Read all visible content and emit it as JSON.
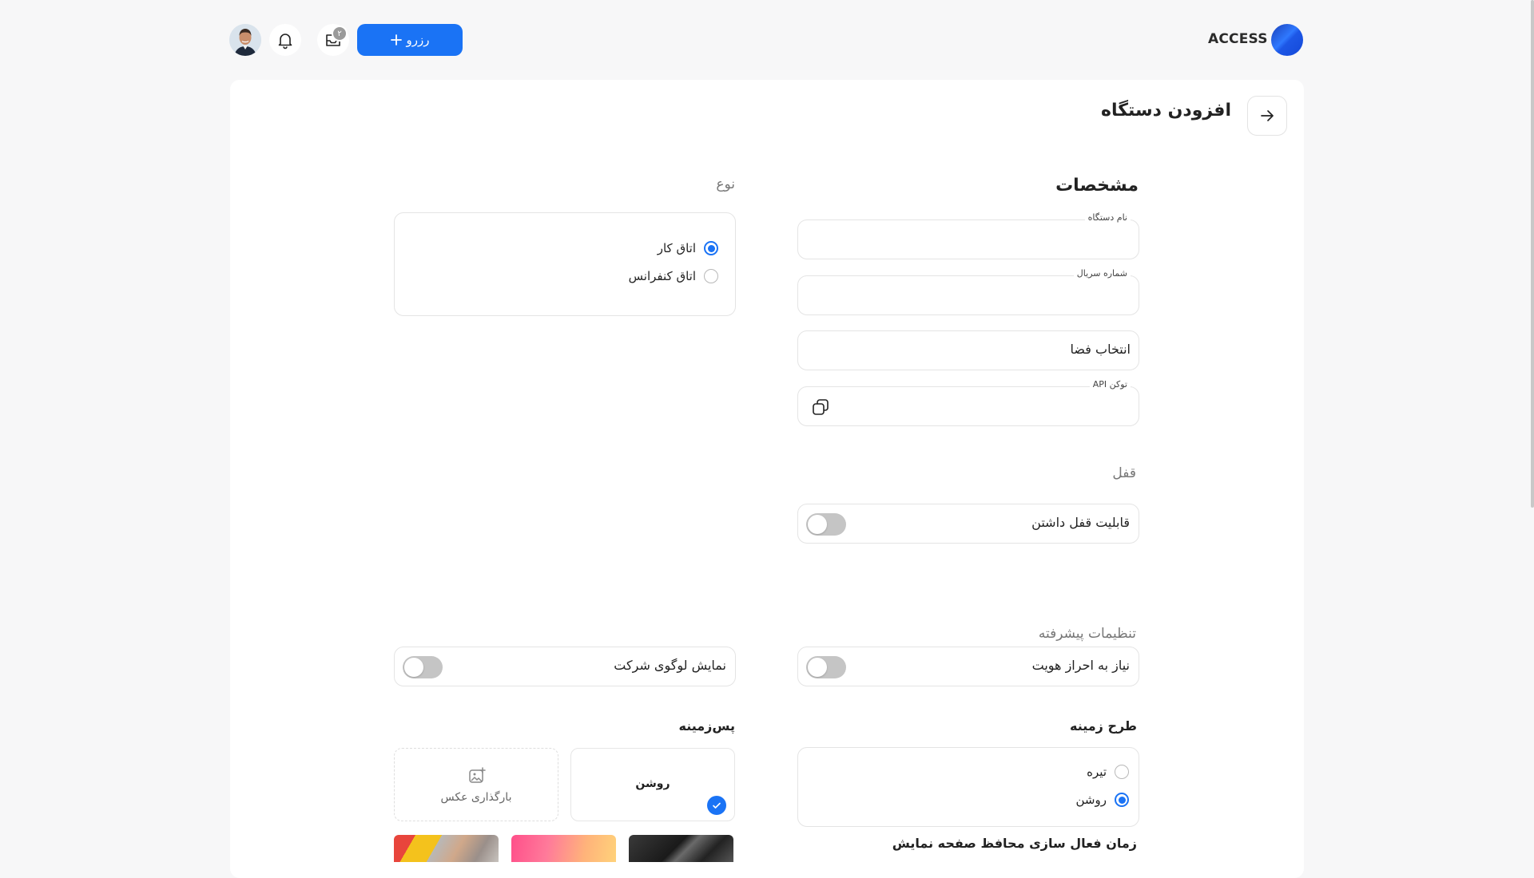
{
  "header": {
    "brand": "ACCESS",
    "reserve_label": "رزرو",
    "inbox_badge": "۲"
  },
  "page": {
    "title": "افزودن دستگاه"
  },
  "specs": {
    "title": "مشخصات",
    "device_name_label": "نام دستگاه",
    "device_name_value": "",
    "serial_label": "شماره سریال",
    "serial_value": "",
    "space_select": "انتخاب فضا",
    "api_token_label": "توکن API",
    "api_token_value": ""
  },
  "type": {
    "title": "نوع",
    "options": [
      {
        "label": "اتاق کار",
        "selected": true
      },
      {
        "label": "اتاق کنفرانس",
        "selected": false
      }
    ]
  },
  "lock": {
    "title": "قفل",
    "lockable_label": "قابلیت قفل داشتن",
    "lockable_on": false
  },
  "advanced": {
    "title": "تنظیمات پیشرفته",
    "auth_required_label": "نیاز به احراز هویت",
    "auth_required_on": false,
    "show_logo_label": "نمایش لوگوی شرکت",
    "show_logo_on": false
  },
  "theme": {
    "title": "طرح زمینه",
    "options": [
      {
        "label": "تیره",
        "selected": false
      },
      {
        "label": "روشن",
        "selected": true
      }
    ]
  },
  "background": {
    "title": "پس‌زمینه",
    "light_label": "روشن",
    "light_selected": true,
    "upload_label": "بارگذاری عکس"
  },
  "screensaver": {
    "title": "زمان فعال سازی محافظ صفحه نمایش"
  },
  "colors": {
    "accent": "#1a73f5",
    "toggle_off": "#c5c5c5"
  }
}
